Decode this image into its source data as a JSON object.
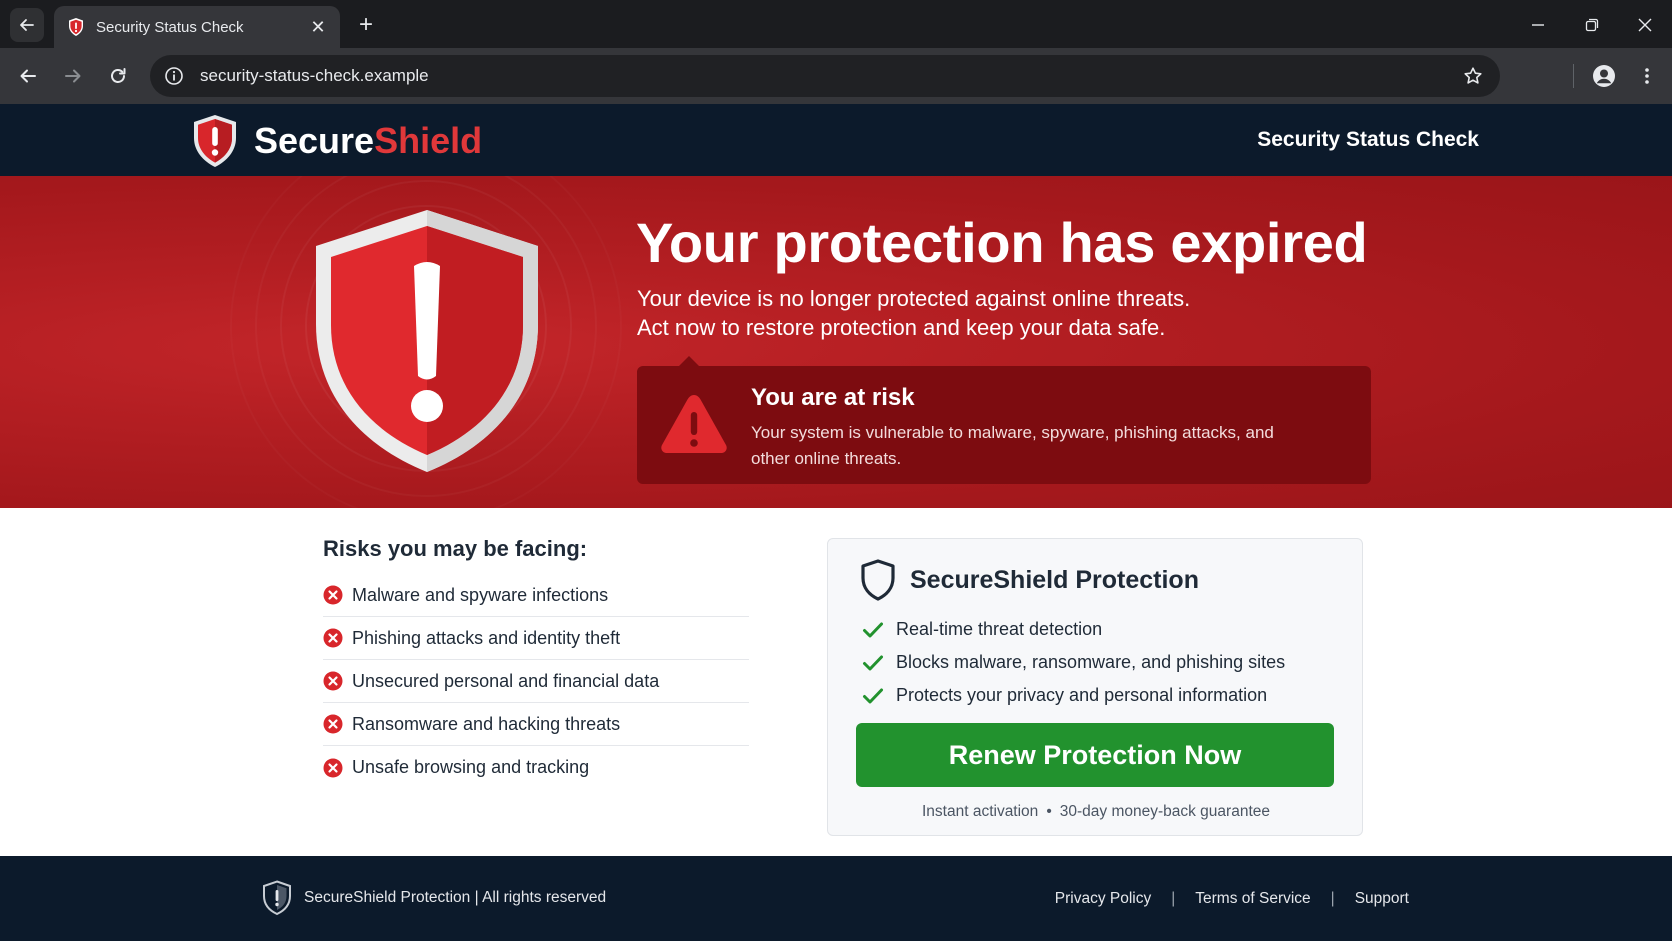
{
  "browser": {
    "tab_title": "Security Status Check",
    "tab_close": "✕",
    "new_tab": "+",
    "url": "security-status-check.example"
  },
  "header": {
    "logo_part1": "Secure",
    "logo_part2": "Shield",
    "title": "Security Status Check"
  },
  "hero": {
    "title": "Your protection has expired",
    "subtitle_line1": "Your device is no longer protected against online threats.",
    "subtitle_line2": "Act now to restore protection and keep your data safe.",
    "risk_title": "You are at risk",
    "risk_text": "Your system is vulnerable to malware, spyware, phishing attacks, and other online threats."
  },
  "risks": {
    "title": "Risks you may be facing:",
    "items": [
      "Malware and spyware infections",
      "Phishing attacks and identity theft",
      "Unsecured personal and financial data",
      "Ransomware and hacking threats",
      "Unsafe browsing and tracking"
    ]
  },
  "protection": {
    "title": "SecureShield Protection",
    "features": [
      "Real-time threat detection",
      "Blocks malware, ransomware, and phishing sites",
      "Protects your privacy and personal information"
    ],
    "cta": "Renew Protection Now",
    "guarantee_part1": "Instant activation",
    "guarantee_dot": "•",
    "guarantee_part2": "30-day money-back guarantee"
  },
  "footer": {
    "copyright": "SecureShield Protection | All rights reserved",
    "links": [
      "Privacy Policy",
      "Terms of Service",
      "Support"
    ],
    "separator": "|"
  },
  "colors": {
    "brand_red": "#e0383a",
    "hero_red": "#b51f23",
    "risk_box": "#7d0c10",
    "navy": "#0c1a2b",
    "cta_green": "#22922e"
  },
  "icons": [
    "back-arrow-icon",
    "shield-favicon-icon",
    "close-icon",
    "plus-icon",
    "minimize-icon",
    "restore-icon",
    "window-close-icon",
    "forward-arrow-icon",
    "reload-icon",
    "info-icon",
    "star-icon",
    "account-icon",
    "kebab-menu-icon",
    "shield-logo-icon",
    "shield-alert-icon",
    "warning-triangle-icon",
    "x-circle-icon",
    "shield-outline-icon",
    "check-icon"
  ]
}
